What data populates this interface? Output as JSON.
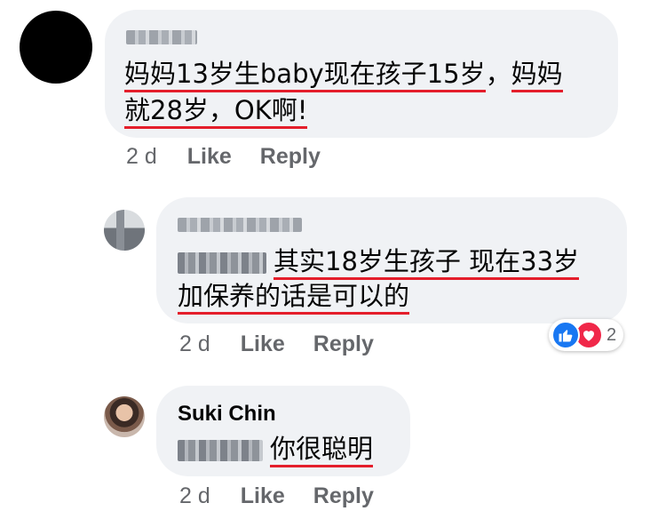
{
  "comments": [
    {
      "author": "",
      "line1": [
        {
          "text": "妈妈13岁生baby现在孩子15岁",
          "underline": true
        },
        {
          "text": "，",
          "underline": false
        },
        {
          "text": "妈妈",
          "underline": true
        }
      ],
      "line2": [
        {
          "text": "就28岁，OK啊!",
          "underline": true
        }
      ],
      "time": "2 d",
      "like_label": "Like",
      "reply_label": "Reply"
    },
    {
      "author": "",
      "line1": [
        {
          "text": "其实18岁生孩子 现在33岁",
          "underline": true
        }
      ],
      "line2": [
        {
          "text": "加保养的话是可以的",
          "underline": true
        }
      ],
      "time": "2 d",
      "like_label": "Like",
      "reply_label": "Reply",
      "reactions": {
        "icons": [
          "like-icon",
          "love-icon"
        ],
        "count": "2"
      }
    },
    {
      "author": "Suki Chin",
      "line1": [
        {
          "text": "你很聪明",
          "underline": true
        }
      ],
      "time": "2 d",
      "like_label": "Like",
      "reply_label": "Reply"
    }
  ],
  "colors": {
    "bubble": "#f0f2f5",
    "underline": "#e41e2b",
    "meta": "#65676b",
    "like_blue": "#1877f2",
    "love_red": "#f02849"
  }
}
